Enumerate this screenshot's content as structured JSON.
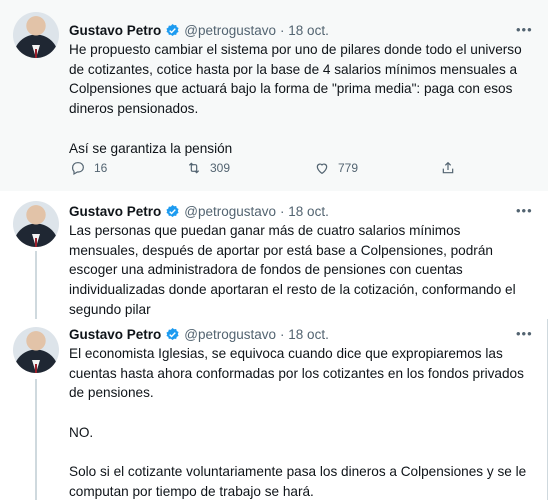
{
  "tweets": [
    {
      "name": "Gustavo Petro",
      "handle": "@petrogustavo",
      "date": "· 18 oct.",
      "more": "•••",
      "text": "He propuesto cambiar el sistema por uno de pilares donde todo el universo de cotizantes, cotice hasta por la base de 4 salarios mínimos mensuales a Colpensiones que actuará bajo la forma de \"prima media\": paga con esos dineros pensionados.\n\nAsí se garantiza la pensión",
      "replies": "16",
      "retweets": "309",
      "likes": "779"
    },
    {
      "name": "Gustavo Petro",
      "handle": "@petrogustavo",
      "date": "· 18 oct.",
      "more": "•••",
      "text": "Las personas que puedan ganar más de cuatro salarios mínimos mensuales, después de aportar por está base a Colpensiones, podrán escoger una administradora de fondos de pensiones con cuentas individualizadas donde aportaran el resto de la cotización, conformando el segundo pilar"
    },
    {
      "name": "Gustavo Petro",
      "handle": "@petrogustavo",
      "date": "· 18 oct.",
      "more": "•••",
      "text": "El economista Iglesias, se equivoca cuando dice que expropiaremos las cuentas hasta ahora conformadas por los cotizantes en los fondos privados de pensiones.\n\nNO.\n\nSolo si el cotizante voluntariamente pasa los dineros a Colpensiones y se le computan por tiempo de trabajo se hará."
    }
  ],
  "icons": {
    "verified": "verified-badge-icon",
    "reply": "reply-icon",
    "retweet": "retweet-icon",
    "like": "heart-icon",
    "share": "share-icon",
    "more": "more-icon"
  },
  "colors": {
    "verified": "#1d9bf0",
    "text": "#0f1419",
    "secondary": "#536471",
    "highlight_bg": "#f7f9f9"
  }
}
